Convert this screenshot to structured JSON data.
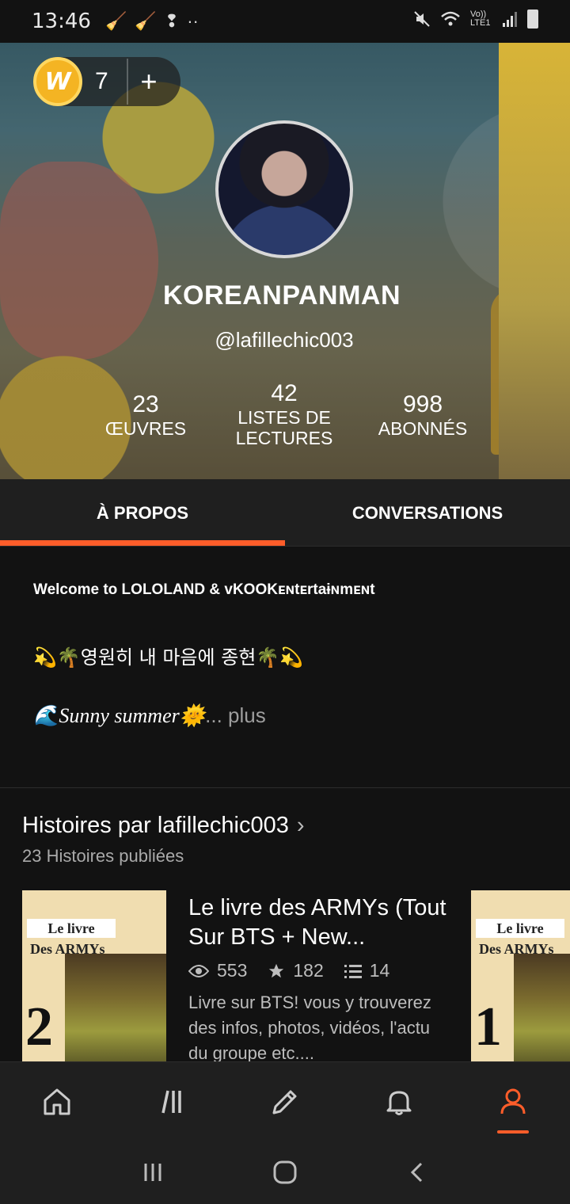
{
  "status_bar": {
    "time": "13:46",
    "network_label": "Vo)) LTE1"
  },
  "header": {
    "coin_count": "7",
    "coin_letter": "W",
    "add_symbol": "+",
    "username": "KOREANPANMAN",
    "handle": "@lafillechic003",
    "stats": [
      {
        "value": "23",
        "label": "ŒUVRES"
      },
      {
        "value": "42",
        "label": "LISTES DE LECTURES"
      },
      {
        "value": "998",
        "label": "ABONNÉS"
      }
    ]
  },
  "tabs": [
    {
      "label": "À PROPOS",
      "active": true
    },
    {
      "label": "CONVERSATIONS",
      "active": false
    }
  ],
  "about": {
    "line1": "Welcome to LOLOLAND & ᴠKOOKᴇɴtᴇrtaɨɴmᴇɴt",
    "line2": "💫🌴영원히 내 마음에 종현🌴💫",
    "line3": "🌊Sunny summer🌞",
    "more": "... plus"
  },
  "stories": {
    "title": "Histoires par lafillechic003",
    "chevron": "›",
    "subtitle": "23 Histoires publiées",
    "items": [
      {
        "cover_label_1": "Le livre",
        "cover_label_2": "Des ARMYs",
        "cover_number": "2",
        "title": "Le livre des ARMYs (Tout Sur BTS + New...",
        "reads": "553",
        "votes": "182",
        "parts": "14",
        "description": "Livre sur BTS!  vous y trouverez des infos, photos, vidéos,  l'actu du groupe etc...."
      },
      {
        "cover_label_1": "Le livre",
        "cover_label_2": "Des ARMYs",
        "cover_number": "1"
      }
    ]
  },
  "accent_color": "#ff5d2a",
  "bottom_nav": [
    "home-icon",
    "library-icon",
    "write-icon",
    "bell-icon",
    "profile-icon"
  ]
}
